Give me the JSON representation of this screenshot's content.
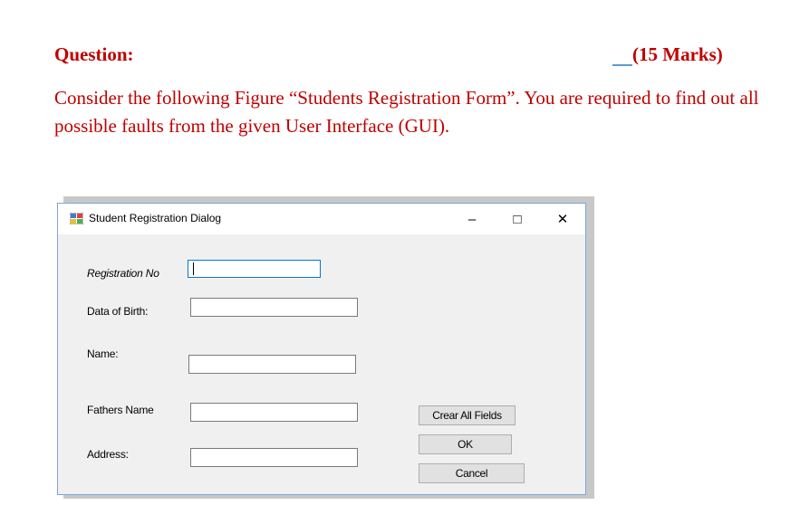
{
  "question": {
    "label": "Question:",
    "marks": "(15 Marks)",
    "text": "Consider the following Figure “Students Registration Form”. You are required to find out all possible faults from the given User Interface (GUI)."
  },
  "dialog": {
    "title": "Student Registration Dialog",
    "controls": {
      "minimize": "–",
      "maximize": "□",
      "close": "✕"
    },
    "labels": {
      "registration_no": "Registration No",
      "dob": "Data of Birth:",
      "name": "Name:",
      "fathers_name": "Fathers Name",
      "address": "Address:"
    },
    "fields": {
      "registration_no": "",
      "dob": "",
      "name": "",
      "fathers_name": "",
      "address": ""
    },
    "buttons": {
      "clear": "Crear All Fields",
      "ok": "OK",
      "cancel": "Cancel"
    }
  },
  "colors": {
    "question_text": "#c00000",
    "dialog_background": "#f0f0f0",
    "focus_border": "#0078d7"
  },
  "icons": [
    "app-form-icon",
    "minimize-icon",
    "maximize-icon",
    "close-icon"
  ]
}
